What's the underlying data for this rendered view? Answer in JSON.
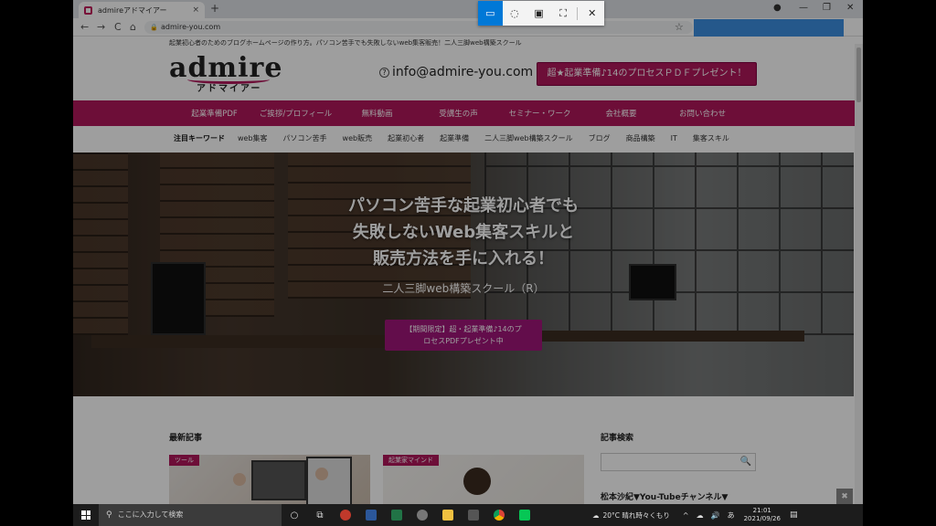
{
  "browser": {
    "tab_title": "admireアドマイアー",
    "tab_close": "×",
    "new_tab": "+",
    "url": "admire-you.com",
    "nav": {
      "back": "←",
      "forward": "→",
      "reload": "C",
      "home": "⌂"
    },
    "star": "☆",
    "menu": "⋮",
    "win_controls": {
      "profile": "●",
      "minimize": "—",
      "maximize": "❐",
      "close": "✕"
    }
  },
  "snip_toolbar": {
    "rect": "▭",
    "freeform": "◌",
    "window": "▣",
    "fullscreen": "⛶",
    "close": "✕"
  },
  "page": {
    "tagline": "起業初心者のためのブログホームページの作り方。パソコン苦手でも失敗しないweb集客販売！二人三脚web構築スクール",
    "logo_word": "admire",
    "logo_kana": "アドマイアー",
    "email_icon": "?",
    "email": "info@admire-you.com",
    "cta_top": "超★起業準備♪14のプロセスＰＤＦプレゼント！",
    "main_nav": [
      "起業準備PDF",
      "ご挨拶/プロフィール",
      "無料動画",
      "受講生の声",
      "セミナー・ワーク",
      "会社概要",
      "お問い合わせ"
    ],
    "keyword_label": "注目キーワード",
    "keywords": [
      "web集客",
      "パソコン苦手",
      "web販売",
      "起業初心者",
      "起業準備",
      "二人三脚web構築スクール",
      "ブログ",
      "商品構築",
      "IT",
      "集客スキル"
    ],
    "hero": {
      "line1": "パソコン苦手な起業初心者でも",
      "line2": "失敗しないWeb集客スキルと",
      "line3": "販売方法を手に入れる！",
      "sub": "二人三脚web構築スクール（R）",
      "cta_line1": "【期間限定】超・起業準備♪14のプ",
      "cta_line2": "ロセスPDFプレゼント中"
    },
    "recent_title": "最新記事",
    "thumb1_badge": "ツール",
    "thumb2_badge": "起業家マインド",
    "search_title": "記事検索",
    "search_icon": "🔍",
    "yt_title": "松本沙紀▼You-Tubeチャンネル▼",
    "float_btn": "✖"
  },
  "taskbar": {
    "search_placeholder": "ここに入力して検索",
    "search_icon": "⚲",
    "cortana": "○",
    "taskview": "⧉",
    "weather": "20°C 晴れ時々くもり",
    "tray_up": "^",
    "tray_ime": "あ",
    "time": "21:01",
    "date": "2021/09/26",
    "notification": "▤"
  },
  "colors": {
    "brand": "#b0185b",
    "snip_active": "#0078d7",
    "highlight": "#3d8fe0"
  }
}
